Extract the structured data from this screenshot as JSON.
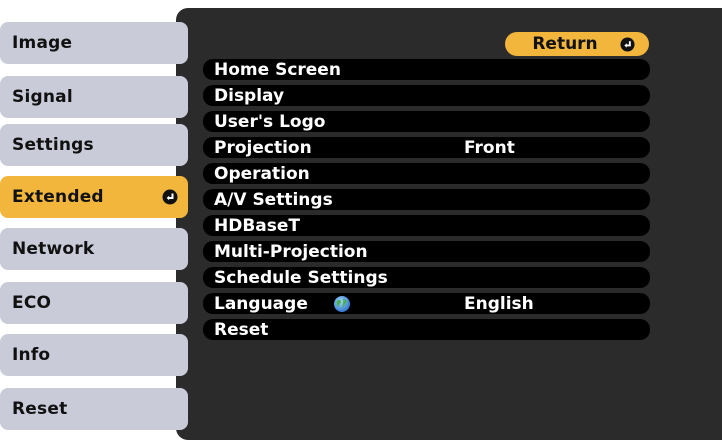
{
  "sidebar": {
    "tabs": [
      {
        "label": "Image",
        "active": false
      },
      {
        "label": "Signal",
        "active": false
      },
      {
        "label": "Settings",
        "active": false
      },
      {
        "label": "Extended",
        "active": true
      },
      {
        "label": "Network",
        "active": false
      },
      {
        "label": "ECO",
        "active": false
      },
      {
        "label": "Info",
        "active": false
      },
      {
        "label": "Reset",
        "active": false
      }
    ]
  },
  "panel": {
    "return_label": "Return",
    "items": [
      {
        "label": "Home Screen",
        "value": ""
      },
      {
        "label": "Display",
        "value": ""
      },
      {
        "label": "User's Logo",
        "value": ""
      },
      {
        "label": "Projection",
        "value": "Front"
      },
      {
        "label": "Operation",
        "value": ""
      },
      {
        "label": "A/V Settings",
        "value": ""
      },
      {
        "label": "HDBaseT",
        "value": ""
      },
      {
        "label": "Multi-Projection",
        "value": ""
      },
      {
        "label": "Schedule Settings",
        "value": ""
      },
      {
        "label": "Language",
        "value": "English",
        "icon": "globe-icon"
      },
      {
        "label": "Reset",
        "value": ""
      }
    ]
  },
  "colors": {
    "accent": "#f3b63c",
    "tab_bg": "#c9cbd8",
    "panel_bg": "#2b2b2b",
    "row_bg": "#000000"
  }
}
